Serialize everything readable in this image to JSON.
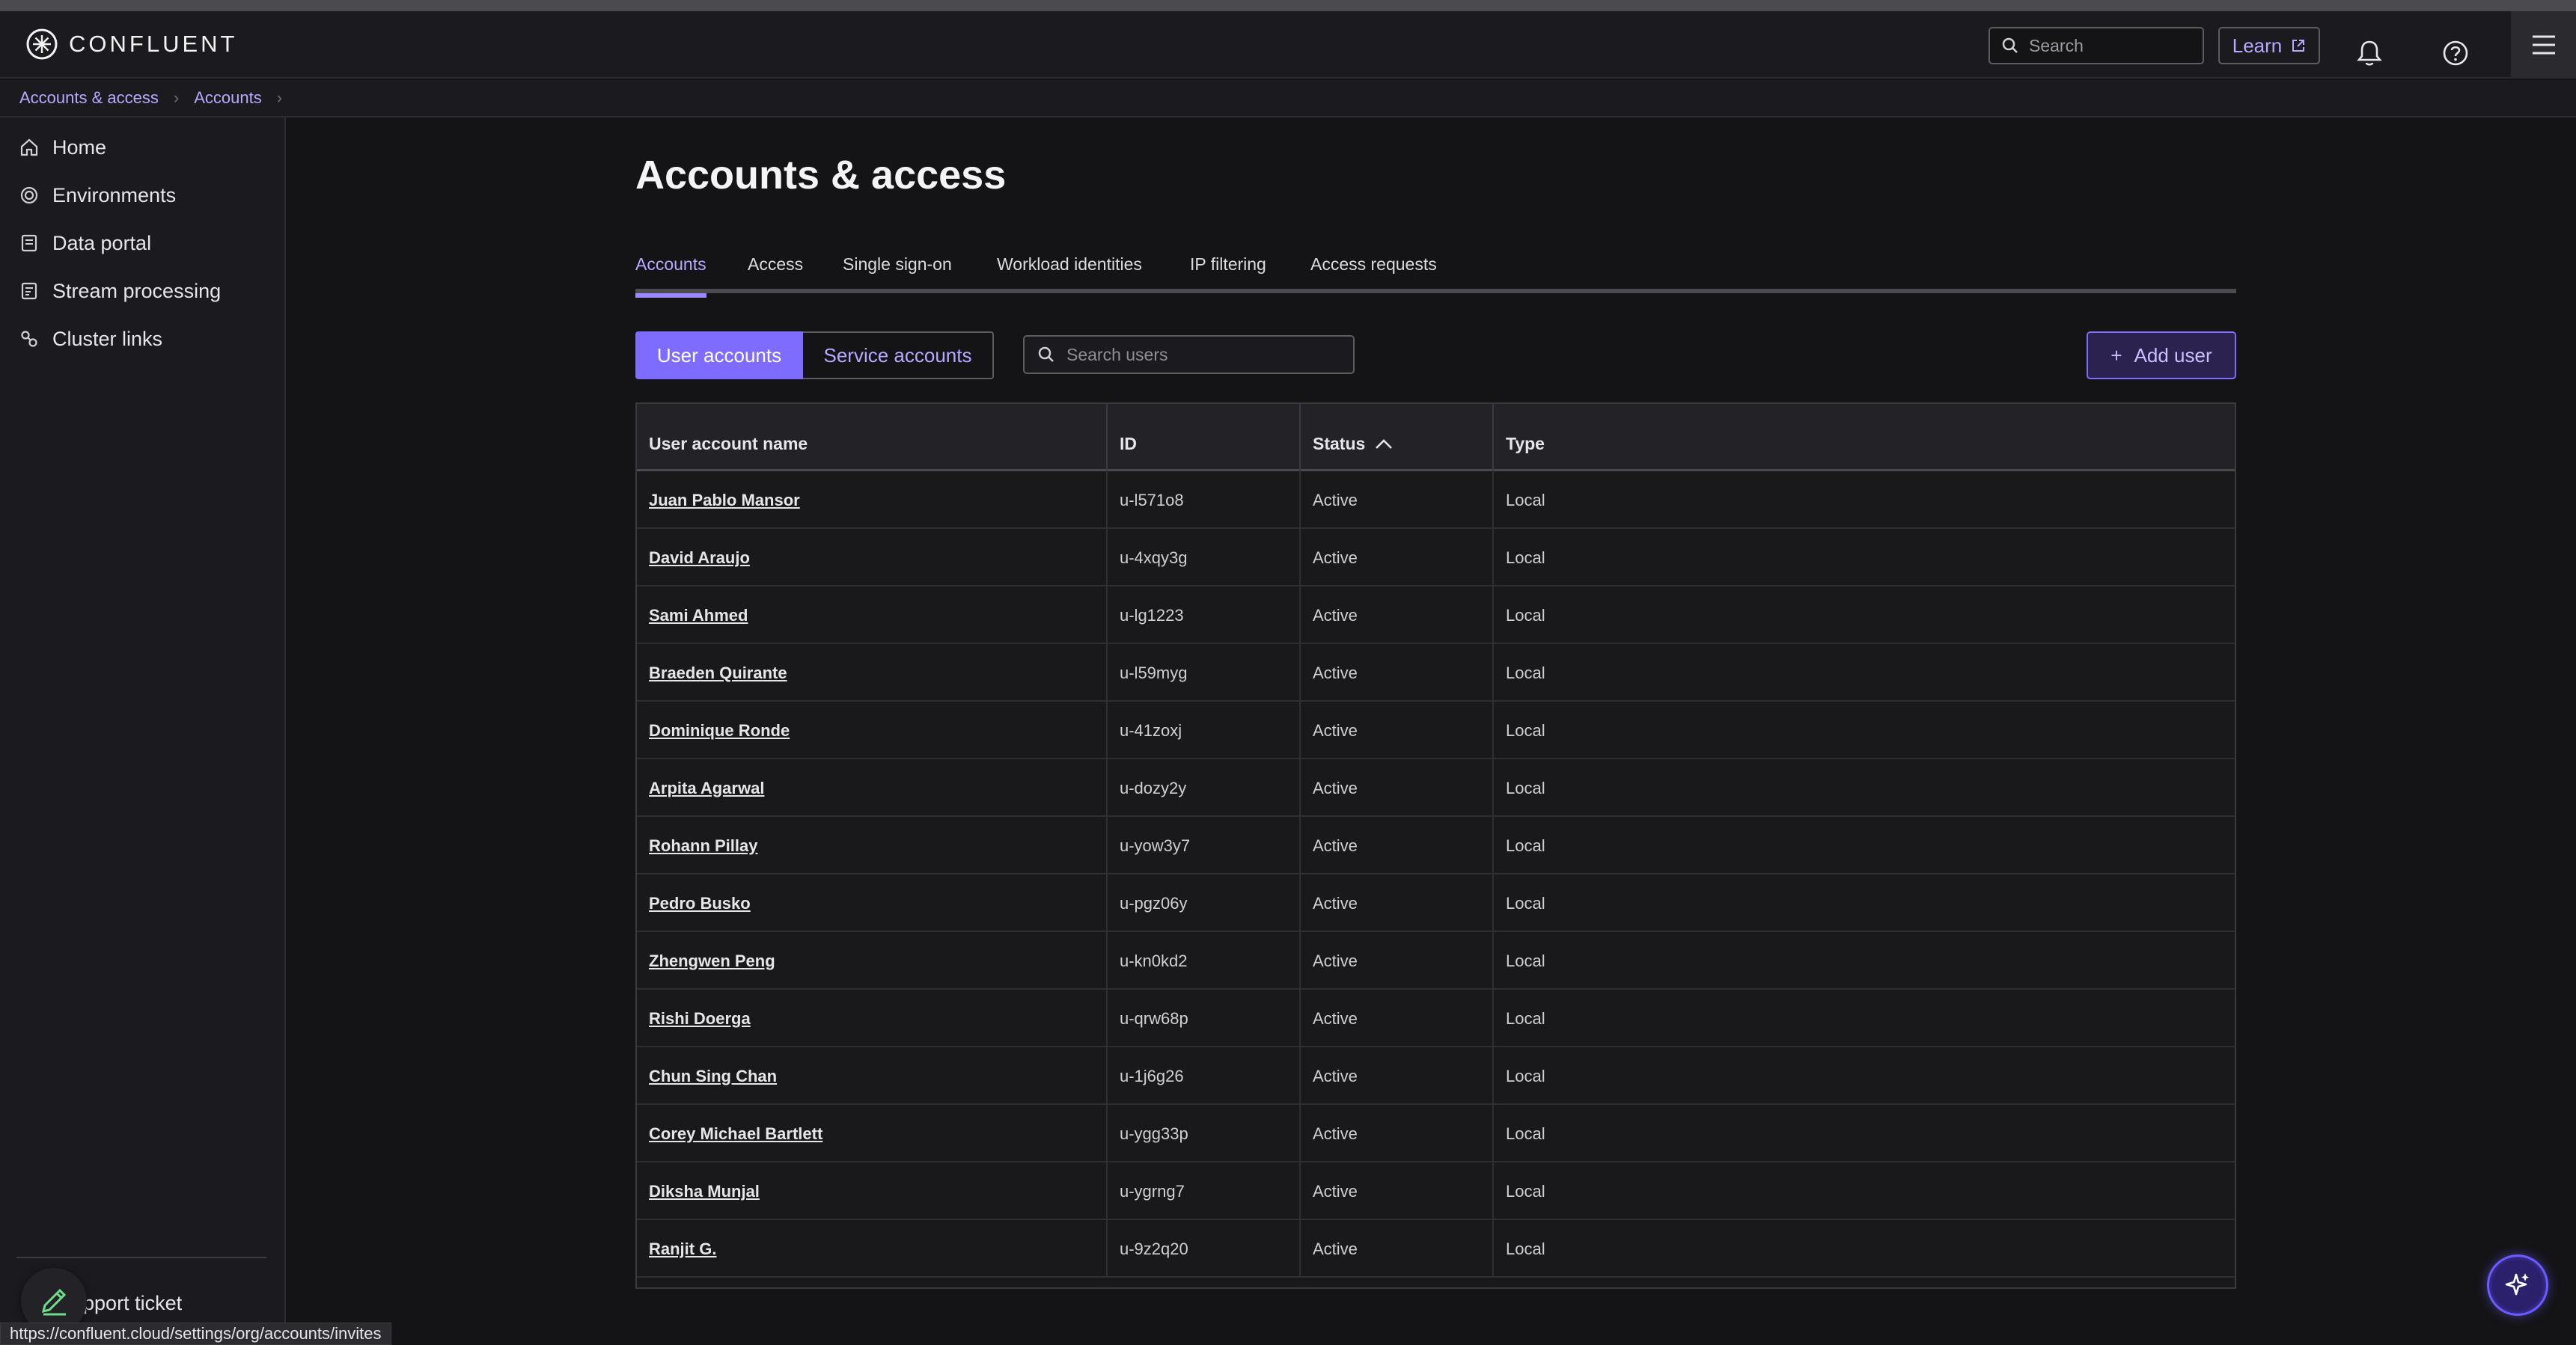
{
  "app": {
    "brand": "CONFLUENT",
    "search_placeholder": "Search",
    "learn_label": "Learn"
  },
  "breadcrumb": [
    "Accounts & access",
    "Accounts"
  ],
  "sidebar": {
    "items": [
      {
        "label": "Home",
        "icon": "home-icon"
      },
      {
        "label": "Environments",
        "icon": "environments-icon"
      },
      {
        "label": "Data portal",
        "icon": "data-portal-icon"
      },
      {
        "label": "Stream processing",
        "icon": "stream-processing-icon"
      },
      {
        "label": "Cluster links",
        "icon": "cluster-links-icon"
      }
    ],
    "support_label": "Support ticket"
  },
  "page": {
    "title": "Accounts & access",
    "tabs": [
      "Accounts",
      "Access",
      "Single sign-on",
      "Workload identities",
      "IP filtering",
      "Access requests"
    ],
    "active_tab": "Accounts",
    "segments": [
      "User accounts",
      "Service accounts"
    ],
    "search_users_placeholder": "Search users",
    "add_user_label": "Add user"
  },
  "table": {
    "columns": [
      "User account name",
      "ID",
      "Status",
      "Type"
    ],
    "sort_column": "Status",
    "rows": [
      {
        "name": "Juan Pablo Mansor",
        "id": "u-l571o8",
        "status": "Active",
        "type": "Local"
      },
      {
        "name": "David Araujo",
        "id": "u-4xqy3g",
        "status": "Active",
        "type": "Local"
      },
      {
        "name": "Sami Ahmed",
        "id": "u-lg1223",
        "status": "Active",
        "type": "Local"
      },
      {
        "name": "Braeden Quirante",
        "id": "u-l59myg",
        "status": "Active",
        "type": "Local"
      },
      {
        "name": "Dominique Ronde",
        "id": "u-41zoxj",
        "status": "Active",
        "type": "Local"
      },
      {
        "name": "Arpita Agarwal",
        "id": "u-dozy2y",
        "status": "Active",
        "type": "Local"
      },
      {
        "name": "Rohann Pillay",
        "id": "u-yow3y7",
        "status": "Active",
        "type": "Local"
      },
      {
        "name": "Pedro Busko",
        "id": "u-pgz06y",
        "status": "Active",
        "type": "Local"
      },
      {
        "name": "Zhengwen Peng",
        "id": "u-kn0kd2",
        "status": "Active",
        "type": "Local"
      },
      {
        "name": "Rishi Doerga",
        "id": "u-qrw68p",
        "status": "Active",
        "type": "Local"
      },
      {
        "name": "Chun Sing Chan",
        "id": "u-1j6g26",
        "status": "Active",
        "type": "Local"
      },
      {
        "name": "Corey Michael Bartlett",
        "id": "u-ygg33p",
        "status": "Active",
        "type": "Local"
      },
      {
        "name": "Diksha Munjal",
        "id": "u-ygrng7",
        "status": "Active",
        "type": "Local"
      },
      {
        "name": "Ranjit G.",
        "id": "u-9z2q20",
        "status": "Active",
        "type": "Local"
      }
    ]
  },
  "status_bar_url": "https://confluent.cloud/settings/org/accounts/invites",
  "colors": {
    "accent": "#7d6cff",
    "accent_text": "#b9a8ff",
    "background": "#141417",
    "panel": "#1b1b1f"
  }
}
